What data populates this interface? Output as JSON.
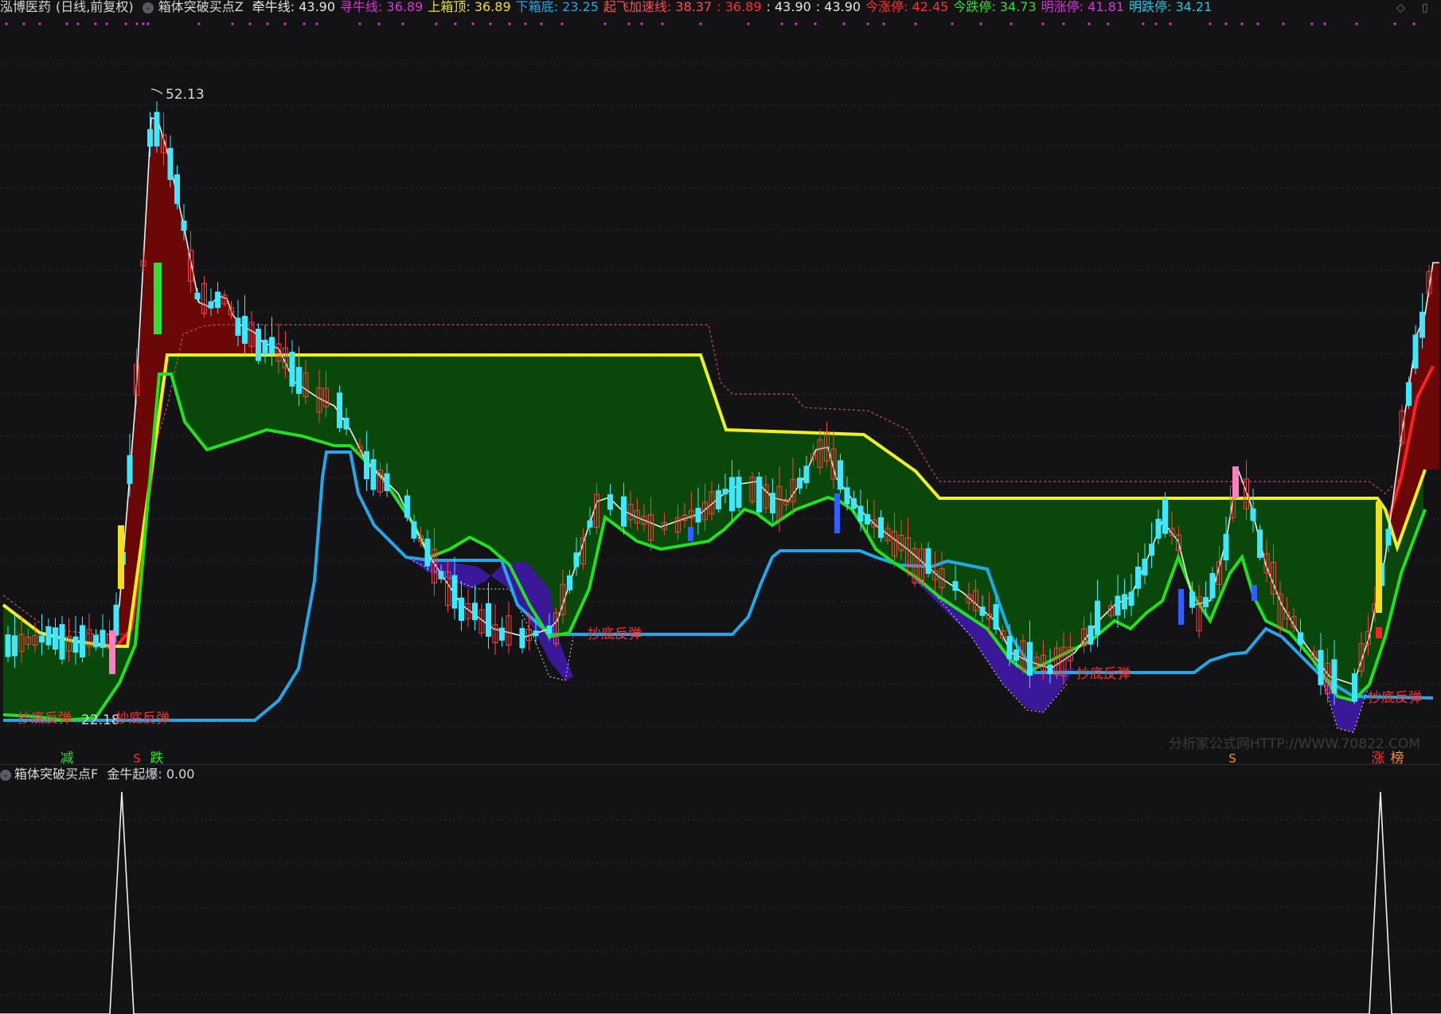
{
  "header": {
    "stock": "泓博医药",
    "period": "(日线,前复权)",
    "indicator": "箱体突破买点Z",
    "items": [
      {
        "label": "牵牛线:",
        "value": "43.90",
        "color": "#e6e6e6"
      },
      {
        "label": "寻牛线:",
        "value": "36.89",
        "color": "#e030e0"
      },
      {
        "label": "上箱顶:",
        "value": "36.89",
        "color": "#f0e020"
      },
      {
        "label": "下箱底:",
        "value": "23.25",
        "color": "#20a8e8"
      },
      {
        "label": "起飞加速线:",
        "value": "38.37",
        "color": "#ff5050"
      },
      {
        "label": ":",
        "value": "36.89",
        "color": "#ff3030"
      },
      {
        "label": ":",
        "value": "43.90",
        "color": "#e6e6e6"
      },
      {
        "label": ":",
        "value": "43.90",
        "color": "#e6e6e6"
      },
      {
        "label": "今涨停:",
        "value": "42.45",
        "color": "#ff3030"
      },
      {
        "label": "今跌停:",
        "value": "34.73",
        "color": "#30e030"
      },
      {
        "label": "明涨停:",
        "value": "41.81",
        "color": "#e030e0"
      },
      {
        "label": "明跌停:",
        "value": "34.21",
        "color": "#20c8e8"
      }
    ]
  },
  "sub_header": {
    "indicator": "箱体突破买点F",
    "label": "金牛起爆:",
    "value": "0.00"
  },
  "annotations": {
    "high": "52.13",
    "low": "22.18",
    "rebound": "抄底反弹",
    "signal_reduce": "减",
    "signal_fall": "跌",
    "signal_s": "S",
    "signal_up": "涨",
    "signal_list": "榜",
    "watermark": "分析家公式网HTTP://WWW.70822.COM"
  },
  "colors": {
    "background": "#131316",
    "up": "#ff4040",
    "down": "#40e8ff",
    "fill_box": "#0a4a0a",
    "fill_high": "#6a0808",
    "fill_low": "#3a1898",
    "green_line": "#20e020",
    "yellow_line": "#f0f020",
    "blue_line": "#20a8e8",
    "white_line": "#f0f0f0",
    "red_dash": "#d05050"
  },
  "chart_data": [
    {
      "type": "candlestick",
      "title": "泓博医药 (日线,前复权) 箱体突破买点Z",
      "price_range": [
        20,
        55
      ],
      "labeled_high": 52.13,
      "labeled_low": 22.18,
      "series": [
        {
          "name": "牵牛线",
          "last": 43.9
        },
        {
          "name": "寻牛线",
          "last": 36.89
        },
        {
          "name": "上箱顶",
          "last": 36.89
        },
        {
          "name": "下箱底",
          "last": 23.25
        },
        {
          "name": "起飞加速线",
          "last": 38.37
        }
      ]
    },
    {
      "type": "line",
      "title": "箱体突破买点F",
      "series": [
        {
          "name": "金牛起爆",
          "last": 0.0
        }
      ],
      "spike_count": 2
    }
  ]
}
